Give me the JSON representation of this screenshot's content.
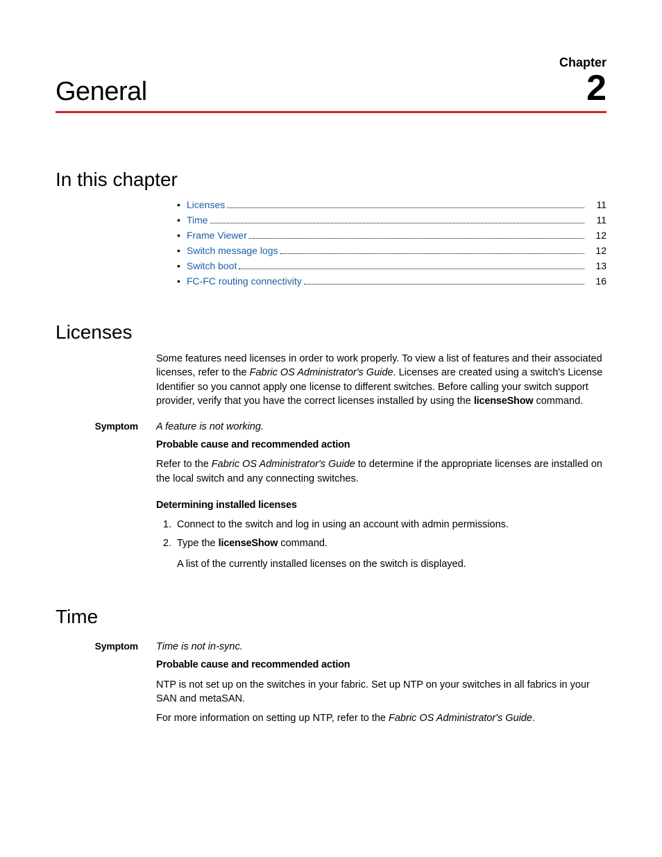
{
  "header": {
    "chapter_prefix": "Chapter",
    "chapter_number": "2",
    "title": "General"
  },
  "sections": {
    "in_chapter": "In this chapter",
    "licenses": "Licenses",
    "time": "Time"
  },
  "toc": [
    {
      "label": "Licenses",
      "page": "11"
    },
    {
      "label": "Time",
      "page": "11"
    },
    {
      "label": "Frame Viewer",
      "page": "12"
    },
    {
      "label": "Switch message logs",
      "page": "12"
    },
    {
      "label": "Switch boot",
      "page": "13"
    },
    {
      "label": "FC-FC routing connectivity",
      "page": "16"
    }
  ],
  "licenses": {
    "intro_pre": "Some features need licenses in order to work properly. To view a list of features and their associated licenses, refer to the ",
    "intro_em": "Fabric OS Administrator's Guide",
    "intro_post": ". Licenses are created using a switch's License Identifier so you cannot apply one license to different switches. Before calling your switch support provider, verify that you have the correct licenses installed by using the ",
    "intro_cmd": "licenseShow",
    "intro_tail": " command.",
    "symptom_label": "Symptom",
    "symptom_text": "A feature is not working.",
    "cause_head": "Probable cause and recommended action",
    "cause_pre": "Refer to the ",
    "cause_em": "Fabric OS Administrator's Guide",
    "cause_post": " to determine if the appropriate licenses are installed on the local switch and any connecting switches.",
    "det_head": "Determining installed licenses",
    "step1": "Connect to the switch and log in using an account with admin permissions.",
    "step2_pre": "Type the ",
    "step2_cmd": "licenseShow",
    "step2_post": " command.",
    "step2_sub": "A list of the currently installed licenses on the switch is displayed."
  },
  "time": {
    "symptom_label": "Symptom",
    "symptom_text": "Time is not in-sync.",
    "cause_head": "Probable cause and recommended action",
    "cause_body": "NTP is not set up on the switches in your fabric. Set up NTP on your switches in all fabrics in your SAN and metaSAN.",
    "more_pre": "For more information on setting up NTP, refer to the ",
    "more_em": "Fabric OS Administrator's Guide",
    "more_post": "."
  }
}
